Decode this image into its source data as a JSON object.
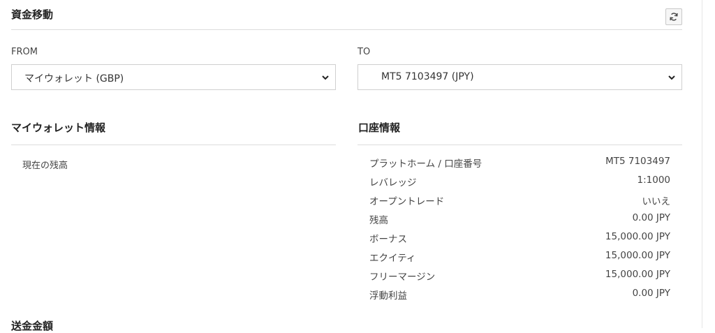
{
  "header": {
    "title": "資金移動",
    "refresh_icon": "refresh-icon"
  },
  "transfer": {
    "from_label": "FROM",
    "from_value": "マイウォレット (GBP)",
    "to_label": "TO",
    "to_value": "MT5 7103497 (JPY)"
  },
  "wallet_info": {
    "title": "マイウォレット情報",
    "balance_label": "現在の残高"
  },
  "account_info": {
    "title": "口座情報",
    "rows": [
      {
        "label": "プラットホーム / 口座番号",
        "value": "MT5 7103497"
      },
      {
        "label": "レバレッジ",
        "value": "1:1000"
      },
      {
        "label": "オープントレード",
        "value": "いいえ"
      },
      {
        "label": "残高",
        "value": "0.00 JPY"
      },
      {
        "label": "ボーナス",
        "value": "15,000.00 JPY"
      },
      {
        "label": "エクイティ",
        "value": "15,000.00 JPY"
      },
      {
        "label": "フリーマージン",
        "value": "15,000.00 JPY"
      },
      {
        "label": "浮動利益",
        "value": "0.00 JPY"
      }
    ]
  },
  "send_amount": {
    "title": "送金金額"
  }
}
